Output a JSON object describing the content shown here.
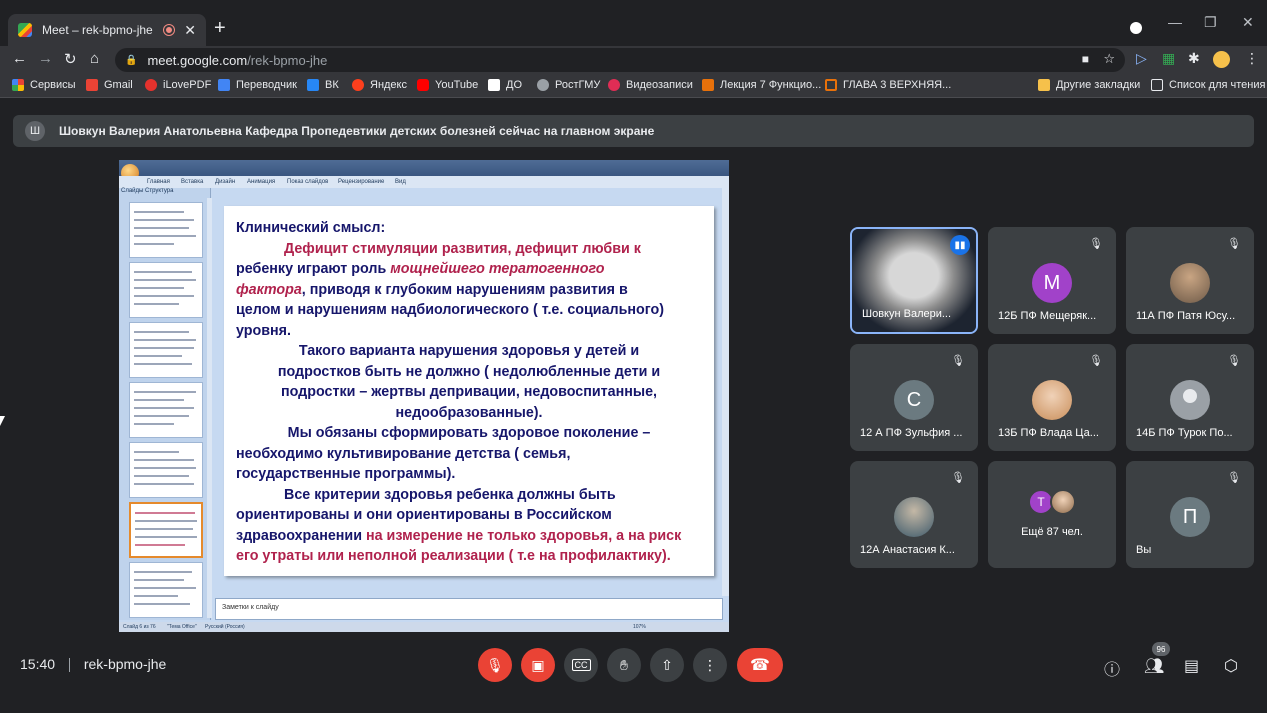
{
  "browser": {
    "tab_title": "Meet – rek-bpmo-jhe",
    "new_tab": "+",
    "url_host": "meet.google.com",
    "url_path": "/rek-bpmo-jhe",
    "bookmarks": [
      {
        "label": "Сервисы",
        "color": "#4285f4"
      },
      {
        "label": "Gmail",
        "color": "#ea4335"
      },
      {
        "label": "iLovePDF",
        "color": "#e5322d"
      },
      {
        "label": "Переводчик",
        "color": "#4285f4"
      },
      {
        "label": "ВК",
        "color": "#2787f5"
      },
      {
        "label": "Яндекс",
        "color": "#fc3f1d"
      },
      {
        "label": "YouTube",
        "color": "#ff0000"
      },
      {
        "label": "ДО",
        "color": "#ffffff"
      },
      {
        "label": "РостГМУ",
        "color": "#9aa0a6"
      },
      {
        "label": "Видеозаписи",
        "color": "#e02d55"
      },
      {
        "label": "Лекция 7 Функцио...",
        "color": "#e8710a"
      },
      {
        "label": "ГЛАВА 3 ВЕРХНЯЯ...",
        "color": "#e8710a"
      }
    ],
    "other_bookmarks": "Другие закладки",
    "reading_list": "Список для чтения"
  },
  "meet": {
    "presenter_initial": "Ш",
    "presenter_banner": "Шовкун Валерия Анатольевна Кафедра Пропедевтики детских болезней сейчас на главном экране",
    "time": "15:40",
    "meeting_code": "rek-bpmo-jhe",
    "participants_count": "96",
    "tiles": [
      {
        "name": "Шовкун Валери...",
        "initial": "",
        "color": "#9e9e9e",
        "speaking": true
      },
      {
        "name": "12Б ПФ Мещеряк...",
        "initial": "M",
        "color": "#a142c9"
      },
      {
        "name": "11А ПФ Патя Юсу...",
        "initial": "",
        "color": "#8a6d55"
      },
      {
        "name": "12 А ПФ Зульфия ...",
        "initial": "C",
        "color": "#6b7a80"
      },
      {
        "name": "13Б ПФ Влада Ца...",
        "initial": "",
        "color": "#d9b28a"
      },
      {
        "name": "14Б ПФ Турок По...",
        "initial": "",
        "color": "#9aa0a6"
      },
      {
        "name": "12А Анастасия К...",
        "initial": "",
        "color": "#6f8a9a"
      },
      {
        "name": "Ещё 87 чел.",
        "initial": "T",
        "color": "#a142c9"
      },
      {
        "name": "Вы",
        "initial": "П",
        "color": "#6b7a80"
      }
    ]
  },
  "powerpoint": {
    "ribbon_tabs": [
      "Главная",
      "Вставка",
      "Дизайн",
      "Анимация",
      "Показ слайдов",
      "Рецензирование",
      "Вид"
    ],
    "pane_tabs": "Слайды   Структура",
    "notes_placeholder": "Заметки к слайду",
    "status_slide": "Слайд 6 из 76",
    "status_theme": "\"Тема Office\"",
    "status_lang": "Русский (Россия)",
    "status_zoom": "107%",
    "slide": {
      "l1": "Клинический смысл:",
      "l2": "Дефицит стимуляции развития, дефицит любви  к",
      "l3a": "ребенку  играют роль ",
      "l3b": "мощнейшего тератогенного",
      "l4a": "фактора",
      "l4b": ", приводя к  глубоким  нарушениям  развития в",
      "l5": "целом и нарушениям  надбиологического ( т.е. социального)",
      "l6": "уровня.",
      "l7": "Такого варианта  нарушения здоровья  у детей и",
      "l8": "подростков быть не должно  ( недолюбленные дети и",
      "l9": "подростки – жертвы депривации,  недовоспитанные,",
      "l10": "недообразованные).",
      "l11": "Мы обязаны сформировать здоровое поколение –",
      "l12": "необходимо культивирование детства    ( семья,",
      "l13": "государственные программы).",
      "l14": "Все  критерии  здоровья  ребенка  должны  быть",
      "l15": "ориентированы   и   они   ориентированы   в   Российском",
      "l16a": "здравоохранении ",
      "l16b": "на измерение не только здоровья, а на риск",
      "l17": "его утраты или неполной реализации ( т.е на профилактику)."
    }
  }
}
